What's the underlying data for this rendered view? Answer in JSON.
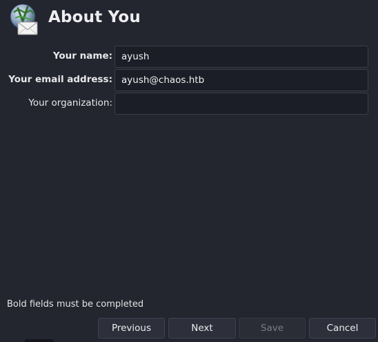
{
  "header": {
    "title": "About You",
    "logo_icon": "mail-wizard-logo-icon"
  },
  "form": {
    "name": {
      "label": "Your name:",
      "value": "ayush",
      "required": true
    },
    "email": {
      "label": "Your email address:",
      "value": "ayush@chaos.htb",
      "required": true
    },
    "organization": {
      "label": "Your organization:",
      "value": "",
      "required": false
    }
  },
  "hint": "Bold fields must be completed",
  "buttons": {
    "previous": "Previous",
    "next": "Next",
    "save": "Save",
    "cancel": "Cancel"
  },
  "colors": {
    "background": "#23252f",
    "input_background": "#1c1e27",
    "button_background": "#2d303b",
    "text": "#e6e6e8",
    "disabled_text": "#7a7c86"
  }
}
